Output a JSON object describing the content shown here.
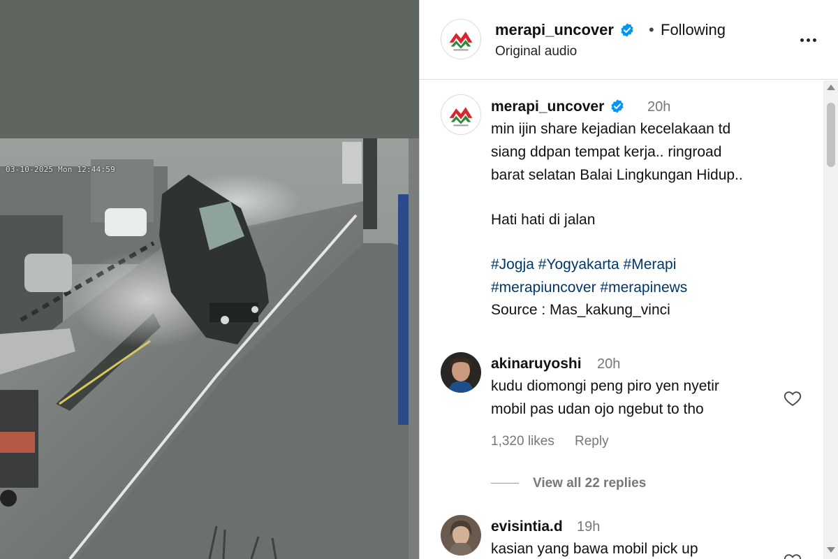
{
  "video": {
    "timestamp": "03-10-2025 Mon 12:44:59"
  },
  "header": {
    "username": "merapi_uncover",
    "separator": "•",
    "following_label": "Following",
    "audio_label": "Original audio",
    "verified": true
  },
  "caption": {
    "username": "merapi_uncover",
    "time": "20h",
    "lines": [
      "min ijin share kejadian kecelakaan td",
      "siang ddpan tempat kerja.. ringroad",
      "barat selatan Balai Lingkungan Hidup..",
      "Hati hati di jalan"
    ],
    "hashtags_line1": "#Jogja #Yogyakarta #Merapi",
    "hashtags_line2": "#merapiuncover #merapinews",
    "source": "Source : Mas_kakung_vinci"
  },
  "comments": [
    {
      "username": "akinaruyoshi",
      "time": "20h",
      "lines": [
        "kudu diomongi peng piro yen nyetir",
        "mobil pas udan ojo ngebut to tho"
      ],
      "likes": "1,320 likes",
      "reply_label": "Reply",
      "view_replies": "View all 22 replies"
    },
    {
      "username": "evisintia.d",
      "time": "19h",
      "lines": [
        "kasian yang bawa mobil pick up"
      ]
    }
  ],
  "colors": {
    "hashtag": "#00376b",
    "verified": "#0095f6",
    "logo_red": "#d7262f",
    "logo_green": "#2e8b3e"
  },
  "icons": [
    "verified-badge-icon",
    "more-options-icon",
    "heart-icon",
    "scroll-up-icon",
    "scroll-down-icon"
  ]
}
